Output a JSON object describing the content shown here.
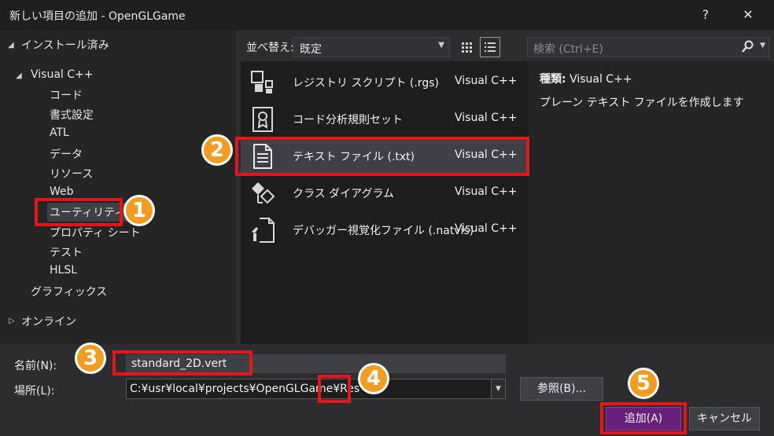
{
  "window": {
    "title": "新しい項目の追加 - OpenGLGame",
    "help": "?",
    "close": "✕"
  },
  "tree": {
    "installed": "インストール済み",
    "visual_cpp": "Visual C++",
    "children": [
      "コード",
      "書式設定",
      "ATL",
      "データ",
      "リソース",
      "Web",
      "ユーティリティ",
      "プロパティ シート",
      "テスト",
      "HLSL"
    ],
    "graphics": "グラフィックス",
    "online": "オンライン"
  },
  "toolbar": {
    "sort_label": "並べ替え:",
    "sort_value": "既定",
    "search_placeholder": "検索 (Ctrl+E)"
  },
  "templates": [
    {
      "name": "レジストリ スクリプト (.rgs)",
      "lang": "Visual C++",
      "icon": "registry-script-icon"
    },
    {
      "name": "コード分析規則セット",
      "lang": "Visual C++",
      "icon": "ruleset-icon"
    },
    {
      "name": "テキスト ファイル (.txt)",
      "lang": "Visual C++",
      "icon": "text-file-icon"
    },
    {
      "name": "クラス ダイアグラム",
      "lang": "Visual C++",
      "icon": "class-diagram-icon"
    },
    {
      "name": "デバッガー視覚化ファイル (.natvis)",
      "lang": "Visual C++",
      "icon": "natvis-file-icon"
    }
  ],
  "details": {
    "type_label": "種類:",
    "type_value": "Visual C++",
    "description": "プレーン テキスト ファイルを作成します"
  },
  "form": {
    "name_label": "名前(N):",
    "name_value": "standard_2D.vert",
    "location_label": "場所(L):",
    "location_value": "C:¥usr¥local¥projects¥OpenGLGame¥Res",
    "browse_label": "参照(B)...",
    "add_label": "追加(A)",
    "cancel_label": "キャンセル"
  },
  "annotations": {
    "step1": "1",
    "step2": "2",
    "step3": "3",
    "step4": "4",
    "step5": "5",
    "highlight_color": "#e4161a",
    "badge_color": "#f39c1f"
  },
  "colors": {
    "window_bg": "#2d2d30",
    "accent_button": "#68217a"
  }
}
